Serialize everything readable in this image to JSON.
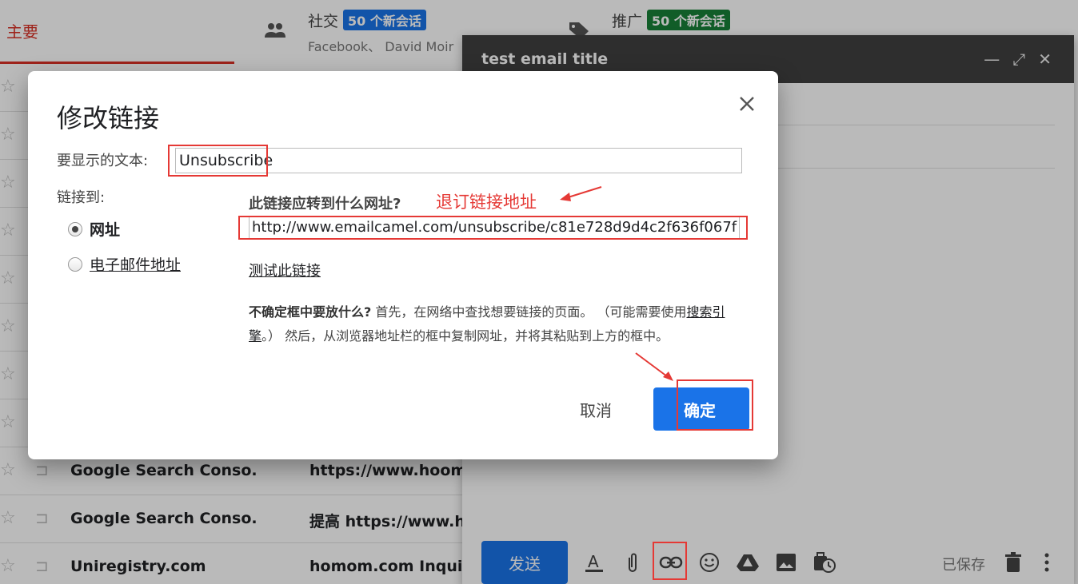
{
  "inbox": {
    "tabs": {
      "primary": "主要",
      "social": {
        "title": "社交",
        "badge": "50 个新会话",
        "sub": "Facebook、 David Moir"
      },
      "promotions": {
        "title": "推广",
        "badge": "50 个新会话"
      }
    },
    "rows": [
      {
        "sender": "",
        "subject": ""
      },
      {
        "sender": "",
        "subject": ""
      },
      {
        "sender": "",
        "subject": ""
      },
      {
        "sender": "",
        "subject": ""
      },
      {
        "sender": "",
        "subject": ""
      },
      {
        "sender": "",
        "subject": ""
      },
      {
        "sender": "",
        "subject": ""
      },
      {
        "sender": "",
        "subject": ""
      },
      {
        "sender": "Google Search Conso.",
        "subject": "https://www.hoomo"
      },
      {
        "sender": "Google Search Conso.",
        "subject": "提高 https://www.ho"
      },
      {
        "sender": "Uniregistry.com",
        "subject": "homom.com Inquiry"
      }
    ]
  },
  "compose": {
    "title": "test email title",
    "send_label": "发送",
    "saved_label": "已保存",
    "toolbar_icons": [
      "format-text-icon",
      "attach-icon",
      "link-icon",
      "emoji-icon",
      "drive-icon",
      "photo-icon",
      "schedule-icon"
    ]
  },
  "dialog": {
    "title": "修改链接",
    "display_text_label": "要显示的文本:",
    "display_text_value": "Unsubscribe",
    "link_to_label": "链接到:",
    "option_web": "网址",
    "option_email": "电子邮件地址",
    "url_question": "此链接应转到什么网址?",
    "url_value": "http://www.emailcamel.com/unsubscribe/c81e728d9d4c2f636f067f",
    "test_link": "测试此链接",
    "help_bold": "不确定框中要放什么?",
    "help_part1": " 首先，在网络中查找想要链接的页面。 （可能需要使用",
    "help_link": "搜索引擎",
    "help_part2": "。） 然后，从浏览器地址栏的框中复制网址，并将其粘贴到上方的框中。",
    "cancel": "取消",
    "ok": "确定"
  },
  "annotation": {
    "text": "退订链接地址",
    "color": "#e53935"
  },
  "colors": {
    "accent": "#1a73e8",
    "primary_tab": "#d93025",
    "promo_badge": "#188038"
  }
}
